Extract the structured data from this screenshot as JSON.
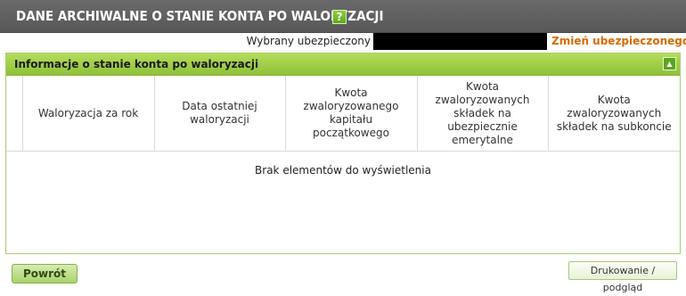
{
  "header": {
    "title": "DANE ARCHIWALNE O STANIE KONTA PO WALORYZACJI",
    "help_label": "?"
  },
  "insured": {
    "label": "Wybrany ubezpieczony",
    "change_link": "Zmień ubezpieczonego"
  },
  "panel": {
    "title": "Informacje o stanie konta po waloryzacji",
    "collapse_icon": "▲",
    "columns": [
      "",
      "Waloryzacja za rok",
      "Data ostatniej waloryzacji",
      "Kwota zwaloryzowanego kapitału początkowego",
      "Kwota zwaloryzowanych składek na ubezpiecznie emerytalne",
      "Kwota zwaloryzowanych składek na subkoncie"
    ],
    "empty_message": "Brak elementów do wyświetlenia"
  },
  "actions": {
    "back_label": "Powrót",
    "print_label": "Drukowanie / podgląd"
  }
}
